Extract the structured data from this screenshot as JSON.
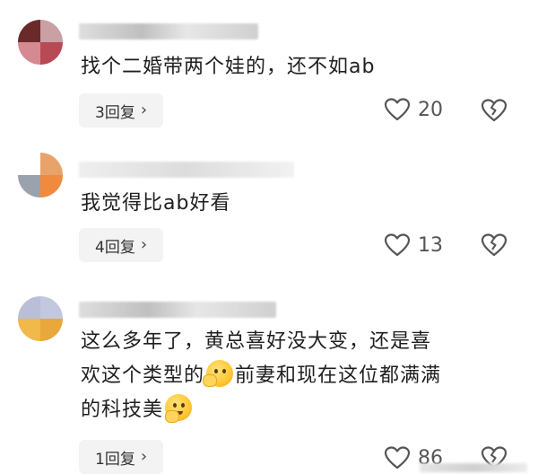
{
  "comments": [
    {
      "text": "找个二婚带两个娃的，还不如ab",
      "reply_label": "3回复",
      "likes": "20",
      "avatar_colors": [
        "#6b2a2a",
        "#c9a0a3",
        "#d48a90",
        "#b84a55"
      ]
    },
    {
      "text": "我觉得比ab好看",
      "reply_label": "4回复",
      "likes": "13",
      "avatar_colors": [
        "#ffffff",
        "#e8a36b",
        "#9aa3ad",
        "#f08a3e"
      ]
    },
    {
      "text_line1": "这么多年了，黄总喜好没大变，还是喜",
      "text_line2_a": "欢这个类型的",
      "text_line2_b": "前妻和现在这位都满满",
      "text_line3": "的科技美",
      "reply_label": "1回复",
      "likes": "86",
      "avatar_colors": [
        "#b9bfd6",
        "#c2c9de",
        "#f1b84a",
        "#e8a83b"
      ],
      "emoji_1": "shushing-face-emoji",
      "emoji_2": "thinking-face-emoji"
    }
  ],
  "icons": {
    "like": "heart-outline-icon",
    "dislike": "broken-heart-icon",
    "reply_more": "chevron-right-icon"
  }
}
